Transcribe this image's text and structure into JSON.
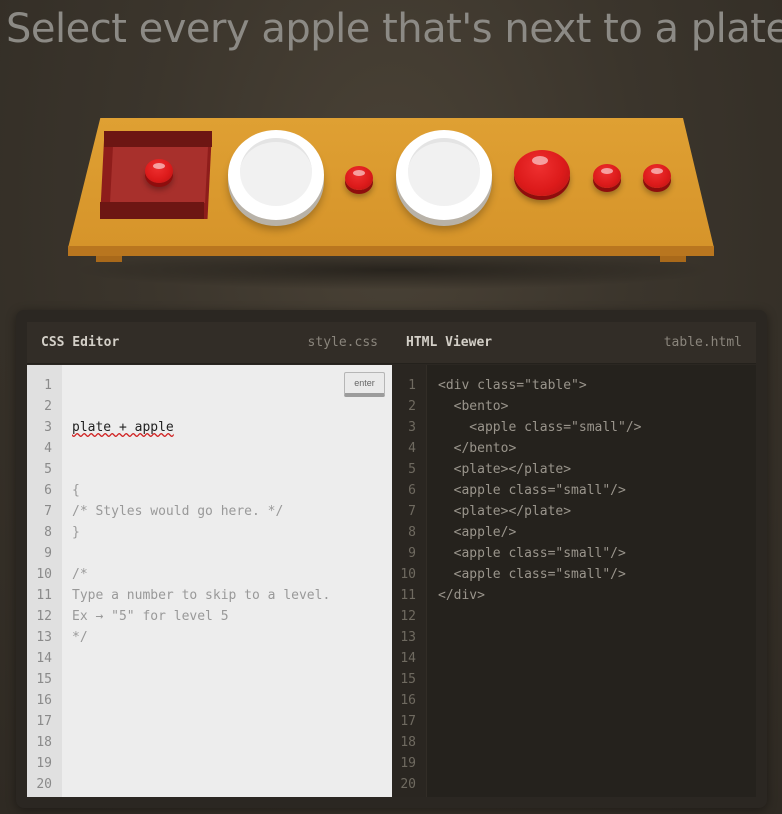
{
  "order_text": "Select every apple that's next to a plate",
  "scene": {
    "items": [
      "bento-with-small-apple",
      "plate",
      "small-apple",
      "plate",
      "apple",
      "small-apple",
      "small-apple"
    ]
  },
  "css_editor": {
    "title": "CSS Editor",
    "file": "style.css",
    "input_value": "plate + apple",
    "enter_label": "enter",
    "lines": [
      "{",
      "/* Styles would go here. */",
      "}",
      "",
      "/*",
      "Type a number to skip to a level.",
      "Ex → \"5\" for level 5",
      "*/"
    ],
    "line_numbers": [
      "1",
      "2",
      "3",
      "4",
      "5",
      "6",
      "7",
      "8",
      "9",
      "10",
      "11",
      "12",
      "13",
      "14",
      "15",
      "16",
      "17",
      "18",
      "19",
      "20"
    ]
  },
  "html_viewer": {
    "title": "HTML Viewer",
    "file": "table.html",
    "lines": [
      "<div class=\"table\">",
      "  <bento>",
      "    <apple class=\"small\"/>",
      "  </bento>",
      "  <plate></plate>",
      "  <apple class=\"small\"/>",
      "  <plate></plate>",
      "  <apple/>",
      "  <apple class=\"small\"/>",
      "  <apple class=\"small\"/>",
      "</div>"
    ],
    "line_numbers": [
      "1",
      "2",
      "3",
      "4",
      "5",
      "6",
      "7",
      "8",
      "9",
      "10",
      "11",
      "12",
      "13",
      "14",
      "15",
      "16",
      "17",
      "18",
      "19",
      "20"
    ]
  },
  "colors": {
    "background": "#3b352c",
    "table": "#d6942a",
    "bento": "#8e1d1b",
    "apple": "#dd1b1b",
    "plate": "#ffffff"
  }
}
